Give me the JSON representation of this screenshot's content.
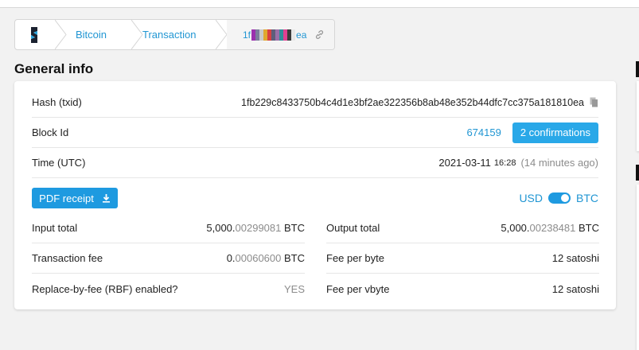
{
  "breadcrumb": {
    "home_icon": "blockchair-logo-icon",
    "items": [
      "Bitcoin",
      "Transaction"
    ],
    "current_prefix": "1f",
    "current_suffix": "ea",
    "redaction_colors": [
      "#9b2fae",
      "#7c7c9c",
      "#c9c9c9",
      "#e0a82e",
      "#d94040",
      "#5e5e7a",
      "#9b6fa8",
      "#2f8f9a",
      "#e04090",
      "#3a3a3a",
      "#e7e7e7"
    ]
  },
  "section_title": "General info",
  "rows": {
    "hash": {
      "label": "Hash (txid)",
      "value": "1fb229c8433750b4c4d1e3bf2ae322356b8ab48e352b44dfc7cc375a181810ea"
    },
    "block": {
      "label": "Block Id",
      "value": "674159",
      "confirmations": "2 confirmations"
    },
    "time": {
      "label": "Time (UTC)",
      "date": "2021-03-11",
      "clock": "16:28",
      "ago": "(14 minutes ago)"
    }
  },
  "pdf_button": "PDF receipt",
  "currency_toggle": {
    "left": "USD",
    "right": "BTC"
  },
  "totals": {
    "input_total": {
      "label": "Input total",
      "int": "5,000.",
      "frac": "00299081",
      "unit": " BTC"
    },
    "output_total": {
      "label": "Output total",
      "int": "5,000.",
      "frac": "00238481",
      "unit": " BTC"
    },
    "fee": {
      "label": "Transaction fee",
      "int": "0.",
      "frac": "00060600",
      "unit": " BTC"
    },
    "fee_per_byte": {
      "label": "Fee per byte",
      "value": "12 satoshi"
    },
    "rbf": {
      "label": "Replace-by-fee (RBF) enabled?",
      "value": "YES"
    },
    "fee_per_vbyte": {
      "label": "Fee per vbyte",
      "value": "12 satoshi"
    }
  },
  "colors": {
    "accent": "#1e9ae0",
    "link": "#2196d3"
  }
}
